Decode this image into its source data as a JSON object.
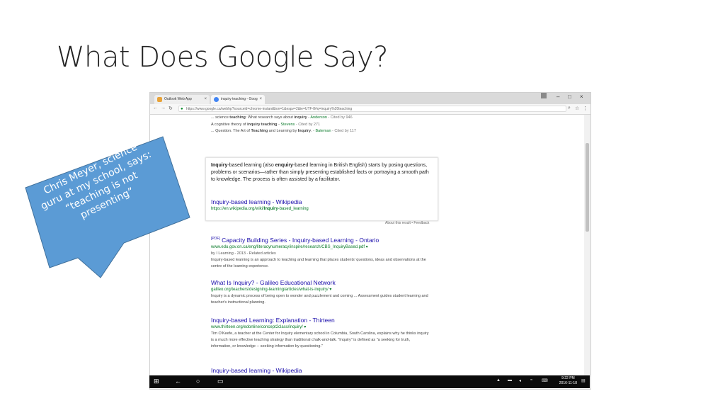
{
  "slide": {
    "title": "What Does Google Say?"
  },
  "callout": {
    "line1": "Chris Meyer, science",
    "line2": "guru at my school, says:",
    "line3": "“teaching is not",
    "line4": "presenting”",
    "fill": "#5b9bd5"
  },
  "browser": {
    "tabs": [
      {
        "label": "Outlook Web App",
        "close": "×"
      },
      {
        "label": "inquiry teaching - Goog",
        "close": "×"
      }
    ],
    "url": "https://www.google.ca/webhp?sourceid=chrome-instant&ion=1&espv=2&ie=UTF-8#q=inquiry%20teaching",
    "win_min": "–",
    "win_max": "□",
    "win_close": "×"
  },
  "top_results": [
    {
      "pre": "... science ",
      "b1": "teaching",
      "mid": ": What research says about ",
      "b2": "inquiry",
      "post": " - ",
      "author": "Anderson",
      "cited": " - Cited by 946"
    },
    {
      "pre": "A cognitive theory of ",
      "b1": "inquiry teaching",
      "mid": "",
      "b2": "",
      "post": " - ",
      "author": "Stevens",
      "cited": " - Cited by 271"
    },
    {
      "pre": "... Question. The Art of ",
      "b1": "Teaching",
      "mid": " and Learning by ",
      "b2": "Inquiry",
      "post": ". - ",
      "author": "Bateman",
      "cited": " - Cited by 117"
    }
  ],
  "knowledge_panel": {
    "b1": "Inquiry",
    "t1": "-based learning (also ",
    "b2": "enquiry",
    "t2": "-based learning in British English) starts by posing questions, problems or scenarios—rather than simply presenting established facts or portraying a smooth path to knowledge. The process is often assisted by a facilitator.",
    "link": "Inquiry-based learning - Wikipedia",
    "url_pre": "https://en.wikipedia.org/wiki/",
    "url_bold": "Inquiry",
    "url_post": "-based_learning",
    "about": "About this result • Feedback"
  },
  "results": [
    {
      "pdf": "[PDF]",
      "title": "Capacity Building Series - Inquiry-based Learning - Ontario",
      "url": "www.edu.gov.on.ca/eng/literacynumeracy/inspire/research/CBS_InquiryBased.pdf ▾",
      "meta": "by I Learning - 2013 - Related articles",
      "desc": "Inquiry-based learning is an approach to teaching and learning that places students' questions, ideas and observations at the centre of the learning experience."
    },
    {
      "pdf": "",
      "title": "What Is Inquiry? - Galileo Educational Network",
      "url": "galileo.org/teachers/designing-learning/articles/what-is-inquiry/ ▾",
      "meta": "",
      "desc": "Inquiry is a dynamic process of being open to wonder and puzzlement and coming ... Assessment guides student learning and teacher's instructional planning."
    },
    {
      "pdf": "",
      "title": "Inquiry-based Learning: Explanation - Thirteen",
      "url": "www.thirteen.org/edonline/concept2class/inquiry/ ▾",
      "meta": "",
      "desc": "Tim O'Keefe, a teacher at the Center for Inquiry elementary school in Columbia, South Carolina, explains why he thinks inquiry is a much more effective teaching strategy than traditional chalk-and-talk. \"Inquiry\" is defined as \"a seeking for truth, information, or knowledge -- seeking information by questioning.\""
    },
    {
      "pdf": "",
      "title": "Inquiry-based learning - Wikipedia",
      "url": "",
      "meta": "",
      "desc": ""
    }
  ],
  "taskbar": {
    "time": "9:22 PM",
    "date": "2016-11-18"
  }
}
